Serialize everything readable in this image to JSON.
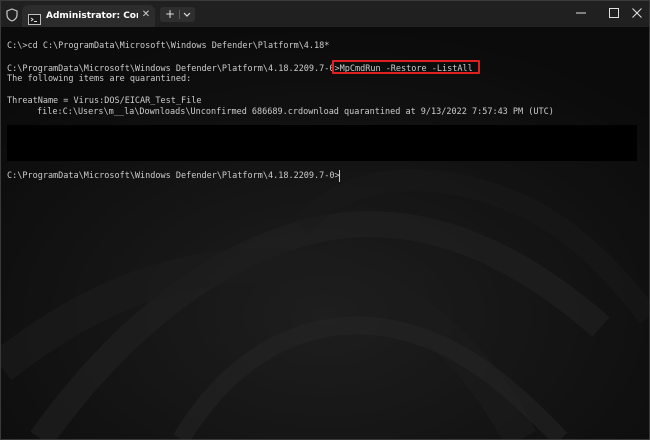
{
  "window": {
    "tab_title": "Administrator: Command Pro",
    "tab_close_glyph": "✕",
    "new_tab_glyph": "+",
    "icons": [
      "shield-icon",
      "cmd-icon",
      "close-icon",
      "plus-icon",
      "chevron-down-icon",
      "minimize-icon",
      "maximize-icon",
      "window-close-icon"
    ]
  },
  "terminal": {
    "lines": [
      "C:\\>cd C:\\ProgramData\\Microsoft\\Windows Defender\\Platform\\4.18*",
      "C:\\ProgramData\\Microsoft\\Windows Defender\\Platform\\4.18.2209.7-0>MpCmdRun -Restore -ListAll",
      "The following items are quarantined:",
      "ThreatName = Virus:DOS/EICAR_Test_File",
      "file:C:\\Users\\m__la\\Downloads\\Unconfirmed 686689.crdownload quarantined at 9/13/2022 7:57:43 PM (UTC)",
      "C:\\ProgramData\\Microsoft\\Windows Defender\\Platform\\4.18.2209.7-0>"
    ],
    "highlighted_command": "MpCmdRun -Restore -ListAll"
  },
  "colors": {
    "titlebar_bg": "#202020",
    "tab_bg": "#2c2c2c",
    "terminal_bg": "#0d0d0d",
    "text": "#cccccc",
    "highlight_border": "#e02020",
    "redaction": "#000000"
  }
}
